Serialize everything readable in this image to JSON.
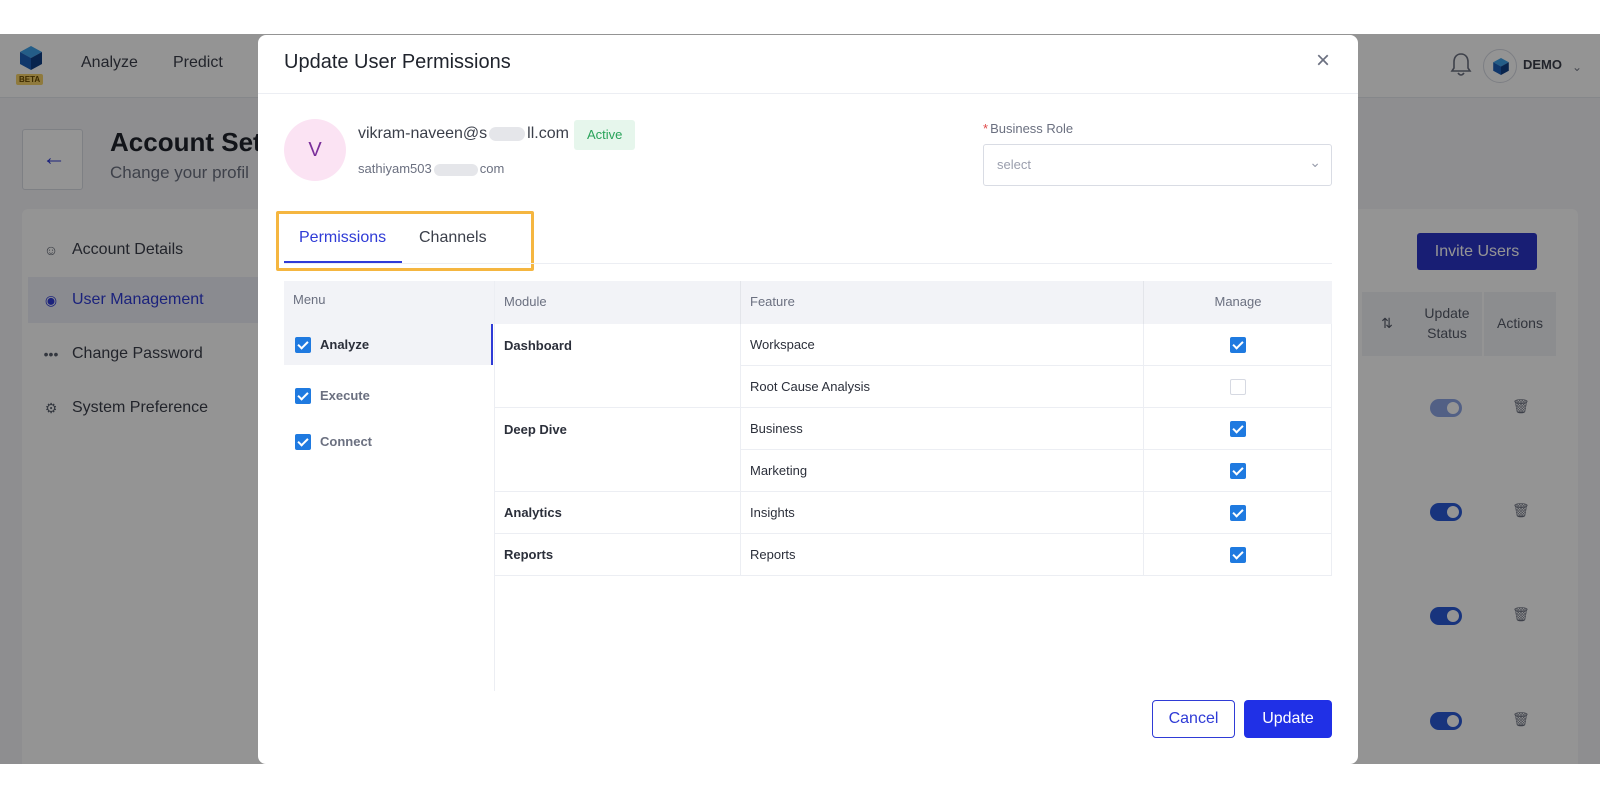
{
  "app": {
    "beta_label": "BETA",
    "nav": [
      "Analyze",
      "Predict"
    ],
    "user_label": "DEMO"
  },
  "page": {
    "title": "Account Set",
    "subtitle": "Change your profil",
    "sidebar": [
      {
        "label": "Account Details",
        "icon": "users-icon"
      },
      {
        "label": "User Management",
        "icon": "user-management-icon",
        "active": true
      },
      {
        "label": "Change Password",
        "icon": "password-dots-icon"
      },
      {
        "label": "System Preference",
        "icon": "gear-icon"
      }
    ],
    "invite_button": "Invite Users",
    "table_headers": {
      "update_status": "Update Status",
      "actions": "Actions"
    }
  },
  "modal": {
    "title": "Update User Permissions",
    "avatar_initial": "V",
    "email_prefix": "vikram-naveen@s",
    "email_suffix": "ll.com",
    "status": "Active",
    "secondary_email_prefix": "sathiyam503",
    "secondary_email_suffix": "com",
    "business_role_label": "Business Role",
    "business_role_required": "*",
    "business_role_placeholder": "select",
    "tabs": [
      "Permissions",
      "Channels"
    ],
    "menu_header": "Menu",
    "menu_items": [
      {
        "label": "Analyze",
        "checked": true
      },
      {
        "label": "Execute",
        "checked": true
      },
      {
        "label": "Connect",
        "checked": true
      }
    ],
    "columns": {
      "module": "Module",
      "feature": "Feature",
      "manage": "Manage"
    },
    "rows": [
      {
        "module": "Dashboard",
        "feature": "Workspace",
        "manage": true
      },
      {
        "module": "",
        "feature": "Root Cause Analysis",
        "manage": false
      },
      {
        "module": "Deep Dive",
        "feature": "Business",
        "manage": true
      },
      {
        "module": "",
        "feature": "Marketing",
        "manage": true
      },
      {
        "module": "Analytics",
        "feature": "Insights",
        "manage": true
      },
      {
        "module": "Reports",
        "feature": "Reports",
        "manage": true
      }
    ],
    "cancel_label": "Cancel",
    "update_label": "Update"
  },
  "colors": {
    "accent": "#2f3bd6",
    "primary_button": "#2030e6",
    "checkbox": "#1f7ae0",
    "highlight_box": "#f5b640",
    "active_badge": "#29a35a"
  }
}
